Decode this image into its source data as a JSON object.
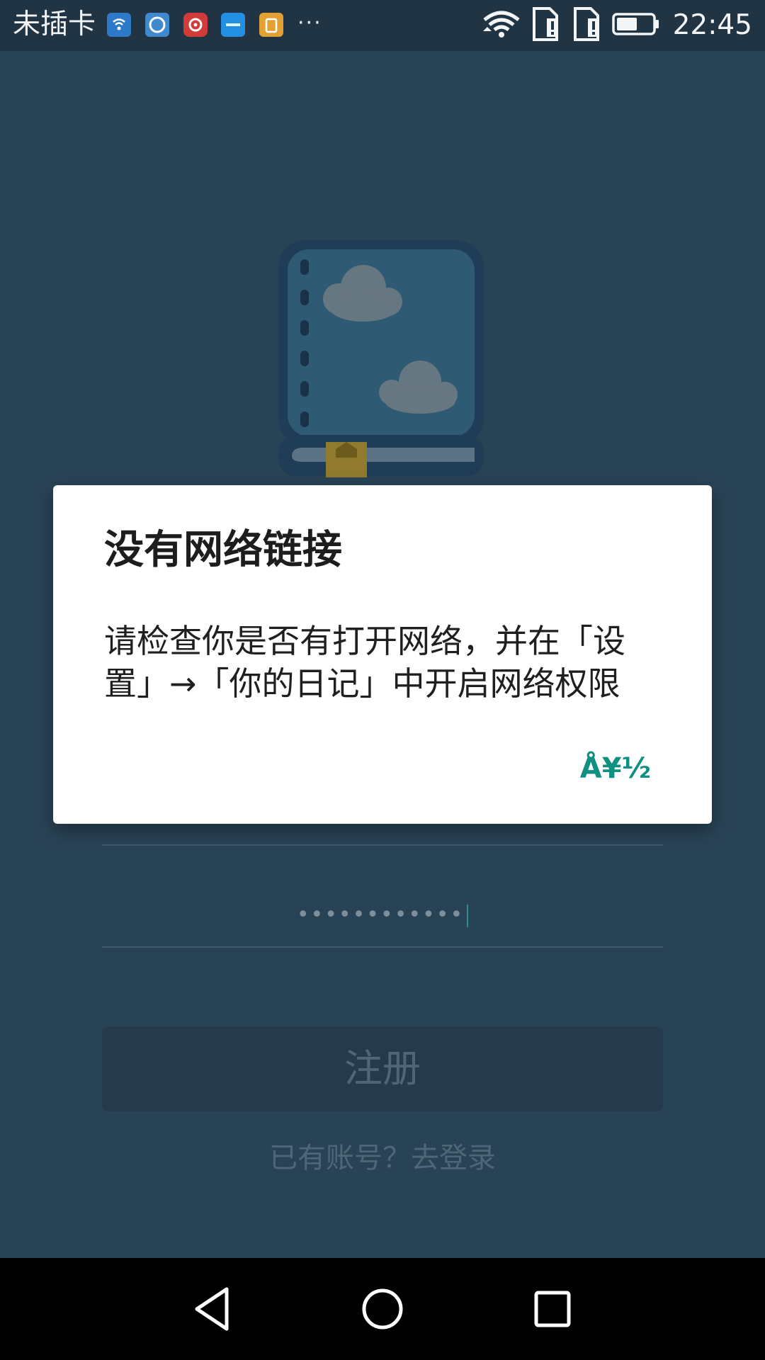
{
  "status_bar": {
    "carrier": "未插卡",
    "more": "···",
    "time": "22:45",
    "icons": [
      "wifi-notification-icon",
      "browser-icon",
      "netease-music-icon",
      "fxui-icon",
      "clipboard-app-icon",
      "wifi-icon",
      "sim-alert-icon",
      "sim-alert-icon",
      "battery-icon"
    ]
  },
  "background": {
    "password_mask": "••••••••••••",
    "register_label": "注册",
    "login_prompt": "已有账号？去登录"
  },
  "dialog": {
    "title": "没有网络链接",
    "message": "请检查你是否有打开网络，并在「设置」→「你的日记」中开启网络权限",
    "confirm_label": "Å¥½"
  },
  "nav_bar": {
    "buttons": [
      "back",
      "home",
      "recent-apps"
    ]
  },
  "colors": {
    "status_bar": "#213444",
    "background": "#294356",
    "dialog": "#ffffff",
    "accent": "#109080",
    "nav_bar": "#000000"
  }
}
